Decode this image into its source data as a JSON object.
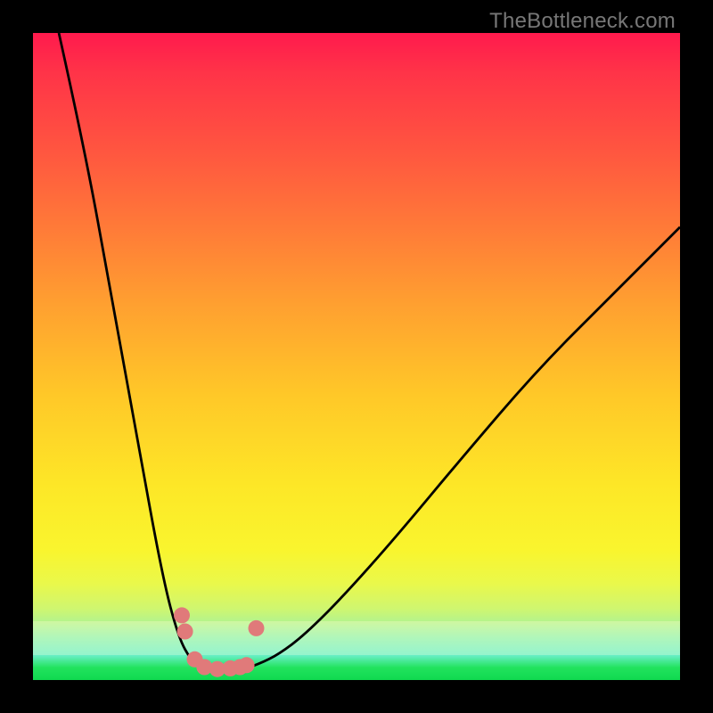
{
  "watermark": "TheBottleneck.com",
  "chart_data": {
    "type": "line",
    "title": "",
    "xlabel": "",
    "ylabel": "",
    "xlim": [
      0,
      100
    ],
    "ylim": [
      0,
      100
    ],
    "grid": false,
    "series": [
      {
        "name": "curve-left",
        "x": [
          4,
          8,
          12,
          16,
          20,
          22.5,
          24.5,
          25.5,
          26.5
        ],
        "values": [
          100,
          82,
          60,
          38,
          16,
          6.5,
          3,
          2,
          1.8
        ]
      },
      {
        "name": "curve-right",
        "x": [
          33,
          35,
          38,
          42,
          48,
          56,
          66,
          78,
          90,
          100
        ],
        "values": [
          1.8,
          2.5,
          4,
          7,
          13,
          22,
          34,
          48,
          60,
          70
        ]
      },
      {
        "name": "valley-floor",
        "x": [
          26.5,
          28,
          30,
          32,
          33
        ],
        "values": [
          1.8,
          1.5,
          1.5,
          1.6,
          1.8
        ]
      }
    ],
    "markers": {
      "name": "sample-points",
      "color": "#e07a7a",
      "points": [
        {
          "x": 23,
          "y": 10
        },
        {
          "x": 23.5,
          "y": 7.5
        },
        {
          "x": 25,
          "y": 3.2
        },
        {
          "x": 26.5,
          "y": 2
        },
        {
          "x": 28.5,
          "y": 1.7
        },
        {
          "x": 30.5,
          "y": 1.8
        },
        {
          "x": 32,
          "y": 2
        },
        {
          "x": 33,
          "y": 2.3
        },
        {
          "x": 34.5,
          "y": 8
        }
      ]
    },
    "background_gradient": {
      "top": "#ff1a4d",
      "middle": "#fde727",
      "bottom": "#0fd94f"
    }
  }
}
